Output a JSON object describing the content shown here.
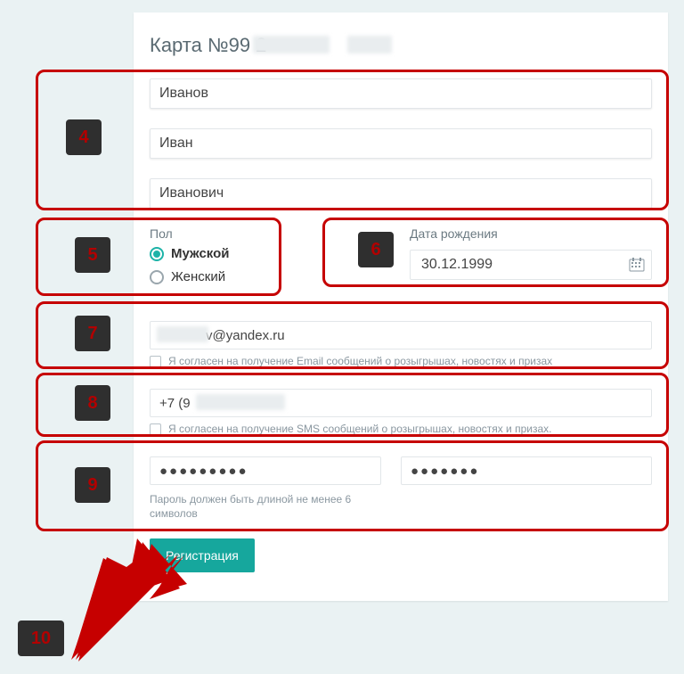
{
  "title": "Карта №99                 2",
  "name": {
    "last": "Иванов",
    "first": "Иван",
    "middle": "Иванович"
  },
  "gender": {
    "label": "Пол",
    "male": "Мужской",
    "female": "Женский"
  },
  "dob": {
    "label": "Дата рождения",
    "value": "30.12.1999"
  },
  "email": {
    "value": "v@yandex.ru",
    "consent": "Я согласен на получение Email сообщений о розыгрышах, новостях и призах"
  },
  "phone": {
    "value": "+7 (9",
    "consent": "Я согласен на получение SMS сообщений о розыгрышах, новостях и призах."
  },
  "password": {
    "value": "●●●●●●●●●",
    "confirm": "●●●●●●●",
    "help": "Пароль должен быть длиной не менее 6 символов"
  },
  "submit": "Регистрация",
  "annot": {
    "n4": "4",
    "n5": "5",
    "n6": "6",
    "n7": "7",
    "n8": "8",
    "n9": "9",
    "n10": "10"
  }
}
